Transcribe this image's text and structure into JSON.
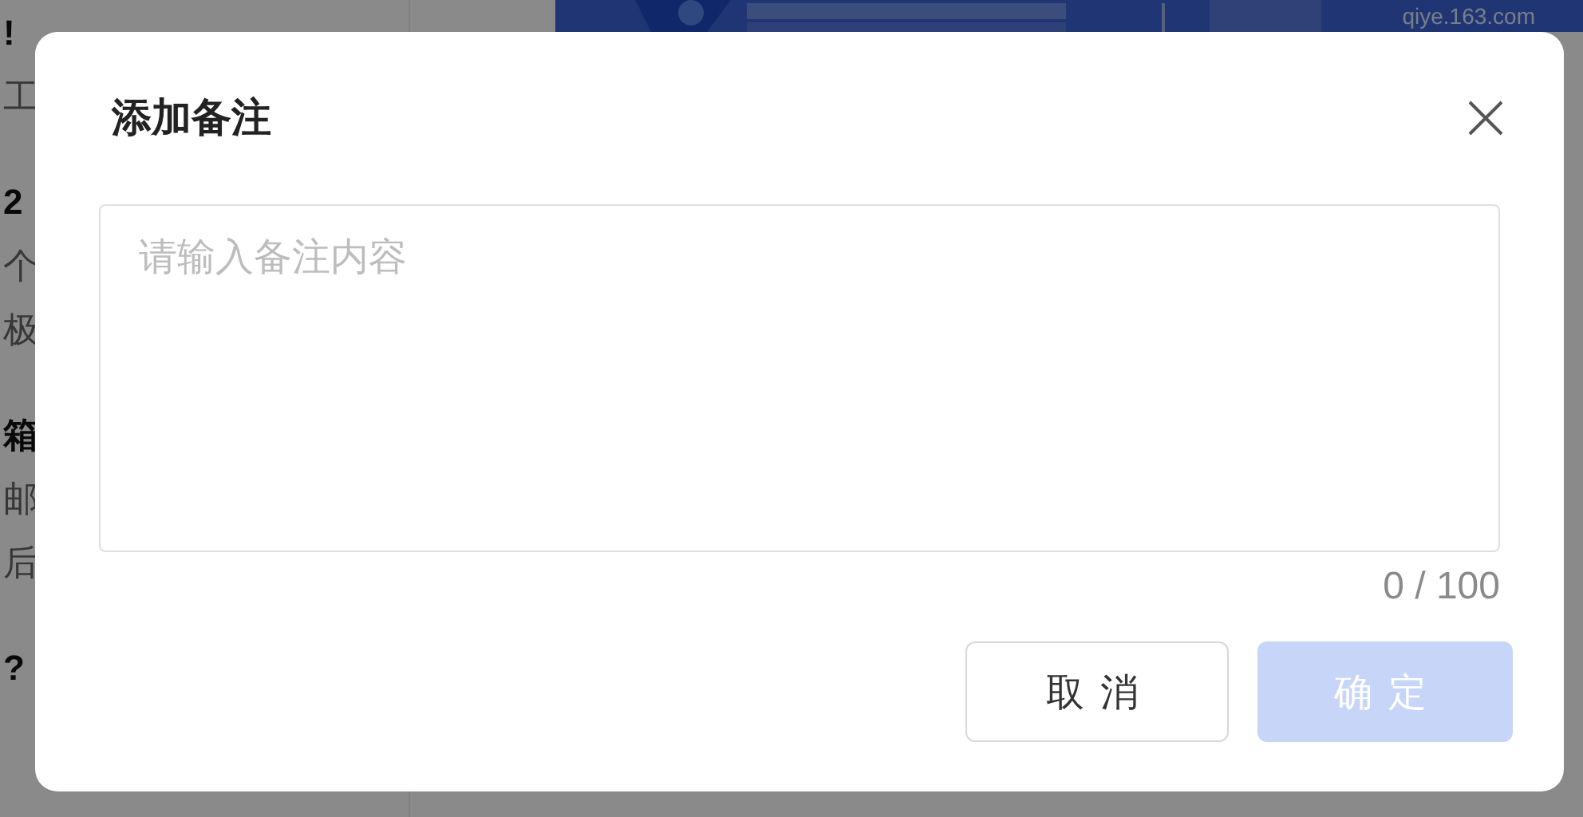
{
  "background": {
    "left_items": [
      {
        "texts": [
          "!",
          "工"
        ]
      },
      {
        "texts": [
          "2",
          "个",
          "极"
        ]
      },
      {
        "texts": [
          "箱",
          "邮",
          "后"
        ]
      },
      {
        "texts": [
          "?"
        ]
      }
    ],
    "banner": {
      "domain": "qiye.163.com"
    }
  },
  "dialog": {
    "title": "添加备注",
    "note_field": {
      "placeholder": "请输入备注内容"
    },
    "counter": "0 / 100",
    "buttons": [
      {
        "label": "取消",
        "kind": "secondary",
        "disabled": false
      },
      {
        "label": "确定",
        "kind": "primary",
        "disabled": true
      }
    ]
  }
}
